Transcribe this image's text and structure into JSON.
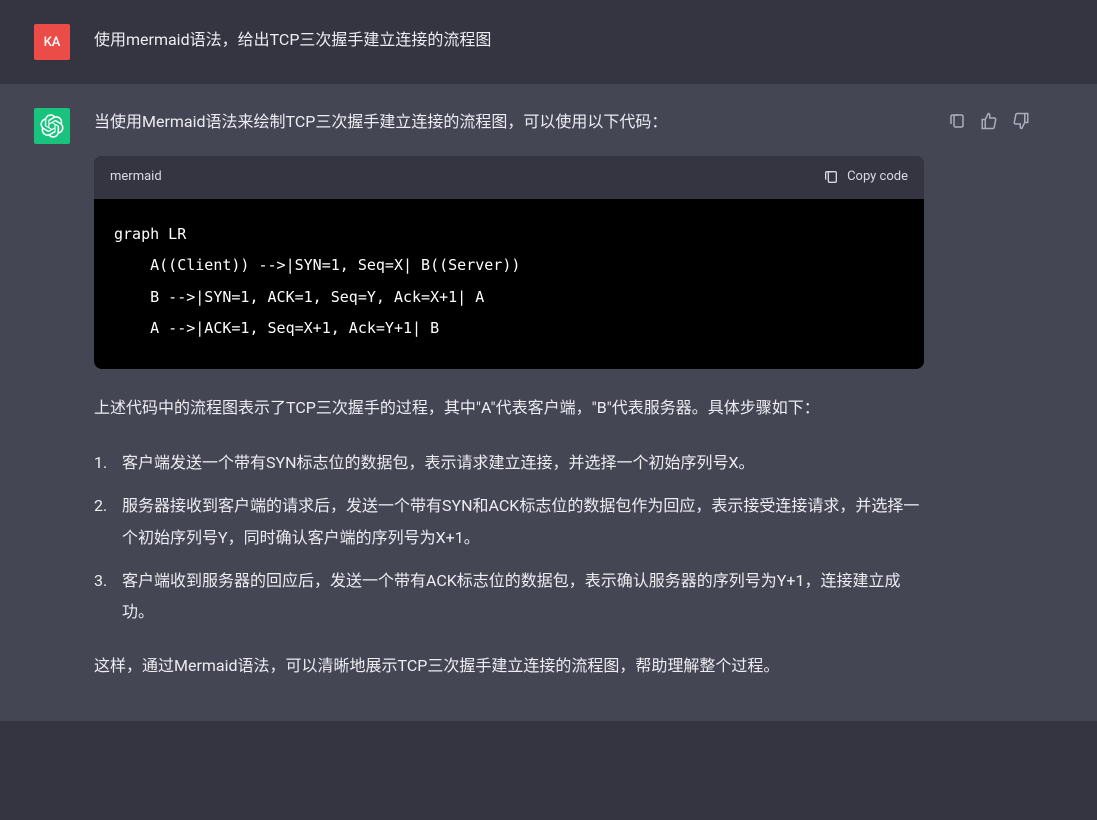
{
  "user": {
    "avatar_text": "KA",
    "message": "使用mermaid语法，给出TCP三次握手建立连接的流程图"
  },
  "assistant": {
    "intro": "当使用Mermaid语法来绘制TCP三次握手建立连接的流程图，可以使用以下代码：",
    "code": {
      "language": "mermaid",
      "copy_label": "Copy code",
      "content": "graph LR\n    A((Client)) -->|SYN=1, Seq=X| B((Server))\n    B -->|SYN=1, ACK=1, Seq=Y, Ack=X+1| A\n    A -->|ACK=1, Seq=X+1, Ack=Y+1| B"
    },
    "explanation": "上述代码中的流程图表示了TCP三次握手的过程，其中\"A\"代表客户端，\"B\"代表服务器。具体步骤如下：",
    "steps": [
      "客户端发送一个带有SYN标志位的数据包，表示请求建立连接，并选择一个初始序列号X。",
      "服务器接收到客户端的请求后，发送一个带有SYN和ACK标志位的数据包作为回应，表示接受连接请求，并选择一个初始序列号Y，同时确认客户端的序列号为X+1。",
      "客户端收到服务器的回应后，发送一个带有ACK标志位的数据包，表示确认服务器的序列号为Y+1，连接建立成功。"
    ],
    "conclusion": "这样，通过Mermaid语法，可以清晰地展示TCP三次握手建立连接的流程图，帮助理解整个过程。"
  }
}
